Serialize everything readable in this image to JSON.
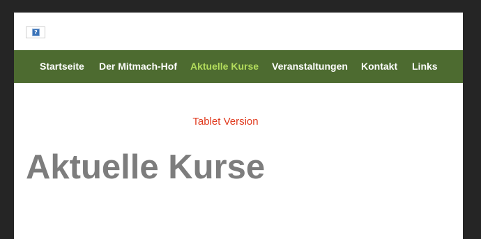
{
  "header": {
    "logo_icon": "broken-image-icon",
    "logo_glyph": "?"
  },
  "nav": {
    "items": [
      {
        "label": "Startseite",
        "active": false
      },
      {
        "label": "Der Mitmach-Hof",
        "active": false
      },
      {
        "label": "Aktuelle Kurse",
        "active": true
      },
      {
        "label": "Veranstaltungen",
        "active": false
      },
      {
        "label": "Kontakt",
        "active": false
      },
      {
        "label": "Links",
        "active": false
      }
    ],
    "background_color": "#4d6b30",
    "active_color": "#b3dc5c"
  },
  "main": {
    "tablet_note": "Tablet Version",
    "title": "Aktuelle Kurse"
  },
  "colors": {
    "frame": "#252525",
    "note": "#e03a1e",
    "title": "#7d7d7d"
  }
}
